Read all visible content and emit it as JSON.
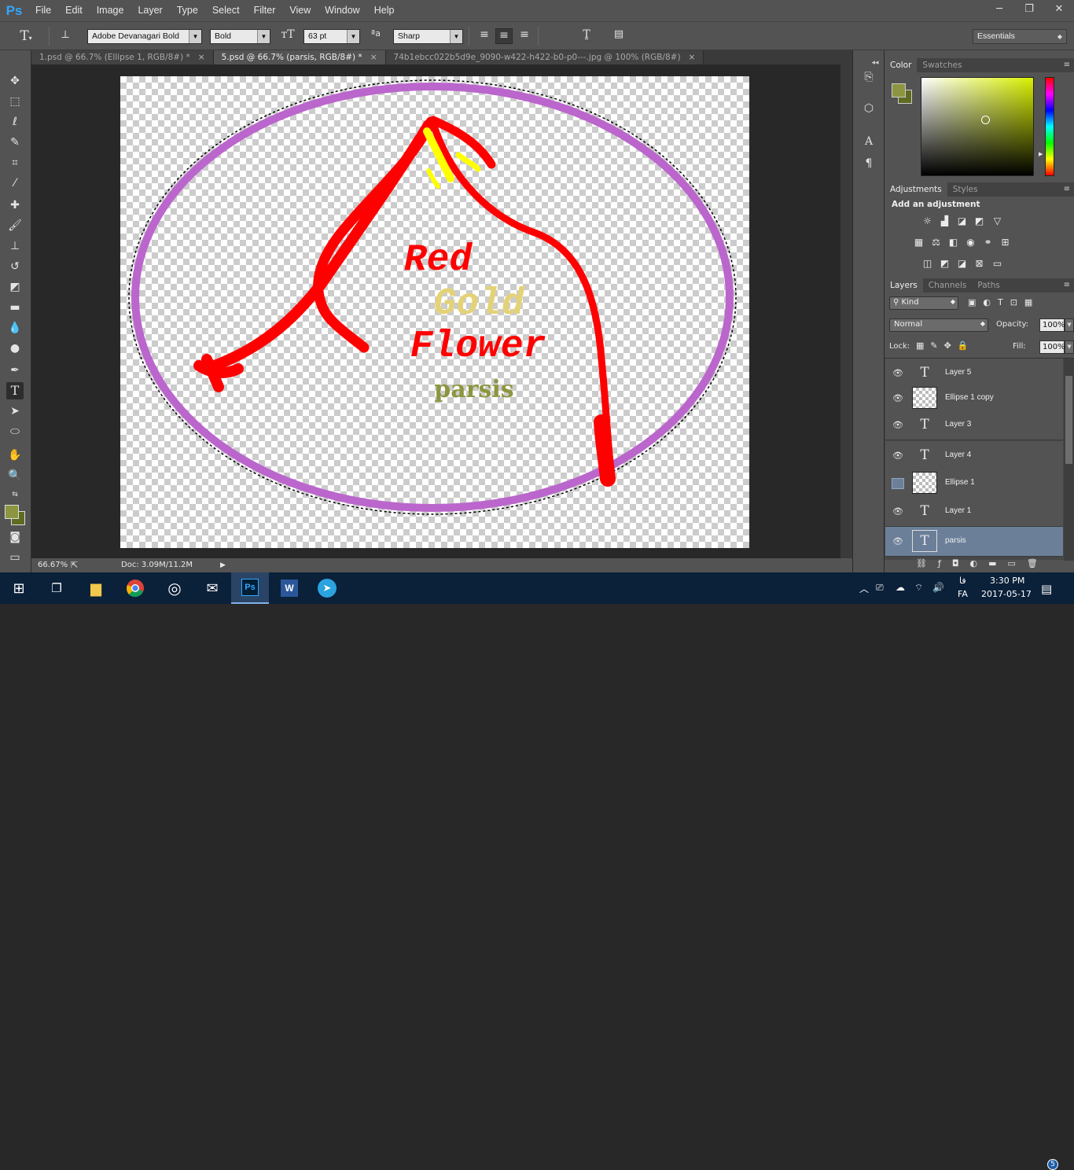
{
  "app": {
    "logo": "Ps"
  },
  "menu": [
    "File",
    "Edit",
    "Image",
    "Layer",
    "Type",
    "Select",
    "Filter",
    "View",
    "Window",
    "Help"
  ],
  "window_controls": {
    "minimize": "─",
    "restore": "❐",
    "close": "✕"
  },
  "options_bar": {
    "font_family": "Adobe Devanagari Bold",
    "font_style": "Bold",
    "font_size": "63 pt",
    "antialias_icon_text": "ªa",
    "antialias": "Sharp",
    "text_color": "#8d9540",
    "workspace": "Essentials"
  },
  "tabs": [
    {
      "label": "1.psd @ 66.7% (Ellipse 1, RGB/8#) *",
      "active": false,
      "close": "×"
    },
    {
      "label": "5.psd @ 66.7% (parsis, RGB/8#) *",
      "active": true,
      "close": "×"
    },
    {
      "label": "74b1ebcc022b5d9e_9090-w422-h422-b0-p0---.jpg @ 100% (RGB/8#)",
      "active": false,
      "close": "×"
    }
  ],
  "canvas_art": {
    "line1": "Red",
    "line2": "Gold",
    "line3": "Flower",
    "line4": "parsis",
    "colors": {
      "red": "#ff0000",
      "gold": "#e4d277",
      "olive": "#8d9540",
      "ellipse": "#bb66cc",
      "yellow": "#ffff00"
    }
  },
  "status": {
    "zoom": "66.67%",
    "doc": "Doc: 3.09M/11.2M"
  },
  "color_panel": {
    "tabs": [
      "Color",
      "Swatches"
    ],
    "foreground": "#8d9540",
    "background": "#5e6b21",
    "picker_hue": "#d9f000"
  },
  "adjustments_panel": {
    "tabs": [
      "Adjustments",
      "Styles"
    ],
    "heading": "Add an adjustment"
  },
  "layers_panel": {
    "tabs": [
      "Layers",
      "Channels",
      "Paths"
    ],
    "filter_kind": "Kind",
    "blend_mode": "Normal",
    "opacity_label": "Opacity:",
    "opacity": "100%",
    "lock_label": "Lock:",
    "fill_label": "Fill:",
    "fill": "100%",
    "layers": [
      {
        "name": "Layer 5",
        "kind": "text",
        "visible": true,
        "selected": false
      },
      {
        "name": "Ellipse 1 copy",
        "kind": "shape",
        "visible": true,
        "selected": false
      },
      {
        "name": "Layer 3",
        "kind": "text",
        "visible": true,
        "selected": false
      },
      {
        "name": "Layer 4",
        "kind": "text",
        "visible": true,
        "selected": false
      },
      {
        "name": "Ellipse 1",
        "kind": "shape",
        "visible": false,
        "selected": false
      },
      {
        "name": "Layer 1",
        "kind": "text",
        "visible": true,
        "selected": false
      },
      {
        "name": "parsis",
        "kind": "text",
        "visible": true,
        "selected": true
      }
    ]
  },
  "taskbar": {
    "clock_time": "3:30 PM",
    "clock_date": "2017-05-17",
    "lang_top": "فا",
    "lang_bottom": "FA",
    "notification_count": "5"
  }
}
